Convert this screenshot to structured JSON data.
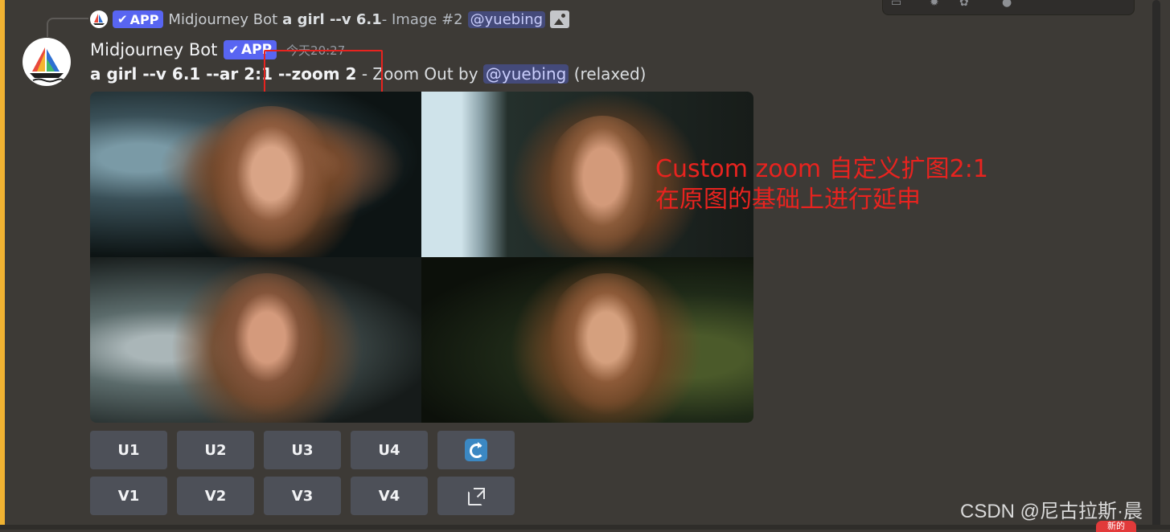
{
  "reply": {
    "app_label": "APP",
    "bot_name": "Midjourney Bot",
    "prompt": "a girl --v 6.1",
    "suffix": " - Image #2",
    "mention": "@yuebing"
  },
  "message": {
    "bot_name": "Midjourney Bot",
    "app_label": "APP",
    "timestamp": "今天20:27",
    "prompt_bold": "a girl --v 6.1 --ar 2:1 --zoom 2",
    "middle_text": " - Zoom Out by ",
    "mention": "@yuebing",
    "mode": " (relaxed)"
  },
  "annotation": {
    "line1": "Custom zoom 自定义扩图2:1",
    "line2": "在原图的基础上进行延申"
  },
  "buttons": {
    "u1": "U1",
    "u2": "U2",
    "u3": "U3",
    "u4": "U4",
    "v1": "V1",
    "v2": "V2",
    "v3": "V3",
    "v4": "V4",
    "reroll_icon": "refresh-icon",
    "web_icon": "external-link-icon"
  },
  "watermark": "CSDN @尼古拉斯·晨",
  "new_badge": "新的",
  "colors": {
    "background": "#3d3a36",
    "accent_bar": "#f0b232",
    "app_badge": "#5865f2",
    "mention_bg": "#444a7a",
    "button_bg": "#4d5058",
    "annotation_red": "#e8231f"
  }
}
